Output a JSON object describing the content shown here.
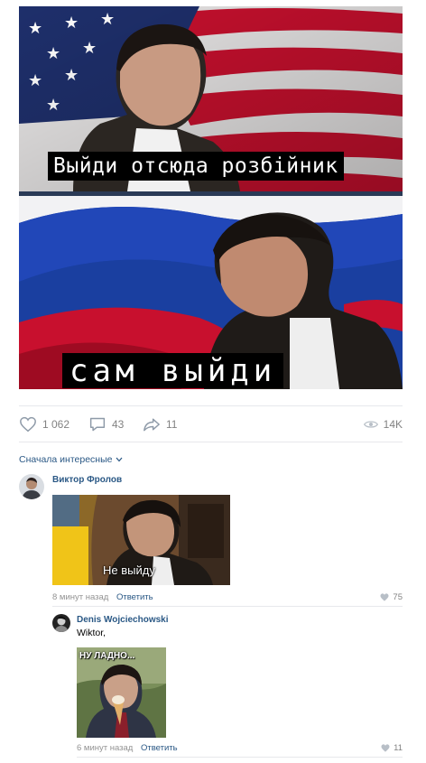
{
  "post": {
    "caption_top": "Выйди отсюда розбійник",
    "caption_bottom": "сам выйди"
  },
  "actions": {
    "likes": "1 062",
    "comments": "43",
    "shares": "11",
    "views": "14K"
  },
  "comments": {
    "sort_label": "Сначала интересные",
    "items": [
      {
        "author": "Виктор Фролов",
        "image_caption": "Не выйду",
        "time": "8 минут назад",
        "reply_label": "Ответить",
        "likes": "75"
      },
      {
        "author": "Denis Wojciechowski",
        "text": "Wiktor,",
        "image_caption": "НУ ЛАДНО...",
        "time": "6 минут назад",
        "reply_label": "Ответить",
        "likes": "11"
      }
    ]
  },
  "colors": {
    "link": "#2a5885",
    "muted": "#828282",
    "flag_red": "#c8102e",
    "flag_blue": "#1a3fa0"
  }
}
